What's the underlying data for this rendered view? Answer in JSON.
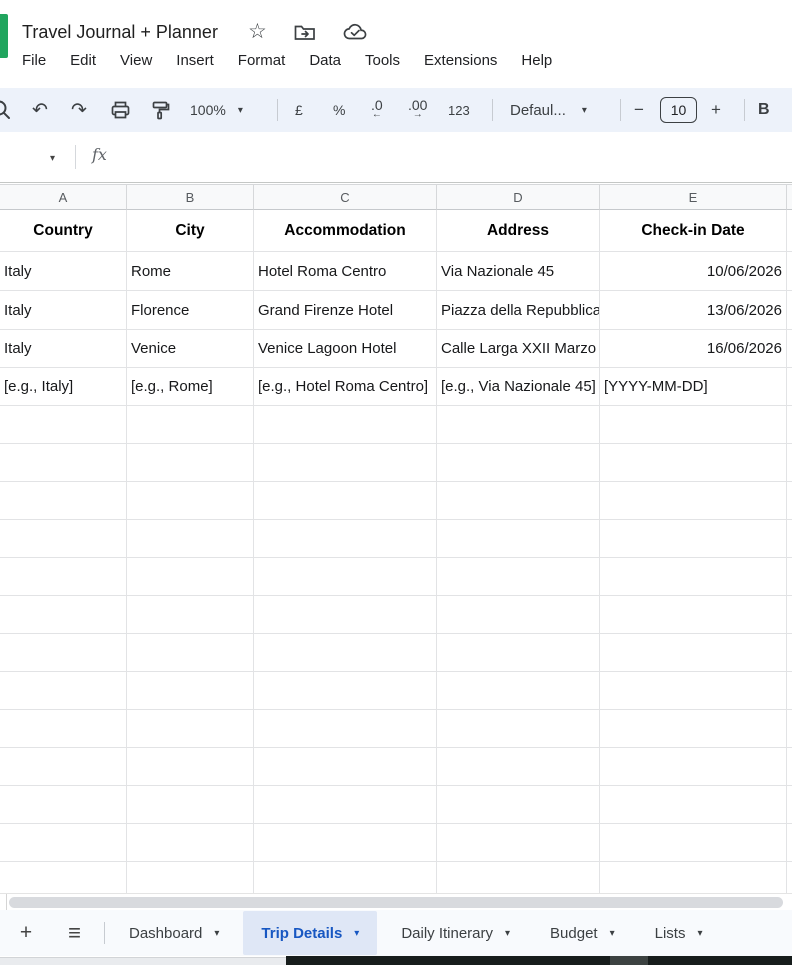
{
  "header": {
    "title": "Travel Journal + Planner",
    "icons": [
      "star",
      "folder-move",
      "cloud-saved"
    ]
  },
  "menu": [
    "File",
    "Edit",
    "View",
    "Insert",
    "Format",
    "Data",
    "Tools",
    "Extensions",
    "Help"
  ],
  "toolbar": {
    "zoom": "100%",
    "currency": "£",
    "percent": "%",
    "decrease_decimals": ".0",
    "decrease_arrow": "←",
    "increase_decimals": ".00",
    "increase_arrow": "→",
    "number_format": "123",
    "font": "Defaul...",
    "font_size": "10",
    "bold": "B"
  },
  "formula_bar": {
    "fx_label": "fx"
  },
  "glyphs": {
    "caret": "▾",
    "star": "☆",
    "undo": "↶",
    "redo": "↷",
    "minus": "−",
    "plus": "+",
    "hamburger": "≡"
  },
  "grid": {
    "column_letters": [
      "A",
      "B",
      "C",
      "D",
      "E",
      ""
    ],
    "header_row": [
      "Country",
      "City",
      "Accommodation",
      "Address",
      "Check-in Date",
      ""
    ],
    "rows": [
      {
        "cells": [
          {
            "text": "Italy"
          },
          {
            "text": "Rome"
          },
          {
            "text": "Hotel Roma Centro"
          },
          {
            "text": "Via Nazionale 45"
          },
          {
            "text": "10/06/2026",
            "align": "right"
          },
          {
            "text": ""
          }
        ]
      },
      {
        "cells": [
          {
            "text": "Italy"
          },
          {
            "text": "Florence"
          },
          {
            "text": "Grand Firenze Hotel"
          },
          {
            "text": "Piazza della Repubblica"
          },
          {
            "text": "13/06/2026",
            "align": "right"
          },
          {
            "text": ""
          }
        ]
      },
      {
        "cells": [
          {
            "text": "Italy"
          },
          {
            "text": "Venice"
          },
          {
            "text": "Venice Lagoon Hotel"
          },
          {
            "text": "Calle Larga XXII Marzo"
          },
          {
            "text": "16/06/2026",
            "align": "right"
          },
          {
            "text": ""
          }
        ]
      },
      {
        "cells": [
          {
            "text": "[e.g., Italy]"
          },
          {
            "text": "[e.g., Rome]"
          },
          {
            "text": "[e.g., Hotel Roma Centro]"
          },
          {
            "text": "[e.g., Via Nazionale 45]"
          },
          {
            "text": "[YYYY-MM-DD]"
          },
          {
            "text": "["
          }
        ]
      }
    ],
    "empty_row_count": 14
  },
  "sheetbar": {
    "tabs": [
      {
        "label": "Dashboard",
        "active": false
      },
      {
        "label": "Trip Details",
        "active": true
      },
      {
        "label": "Daily Itinerary",
        "active": false
      },
      {
        "label": "Budget",
        "active": false
      },
      {
        "label": "Lists",
        "active": false
      }
    ]
  },
  "colors": {
    "logo_green": "#21a55e",
    "toolbar_bg": "#edf2fa",
    "active_tab_text": "#1757c2",
    "active_tab_bg": "#dfe7f6"
  }
}
